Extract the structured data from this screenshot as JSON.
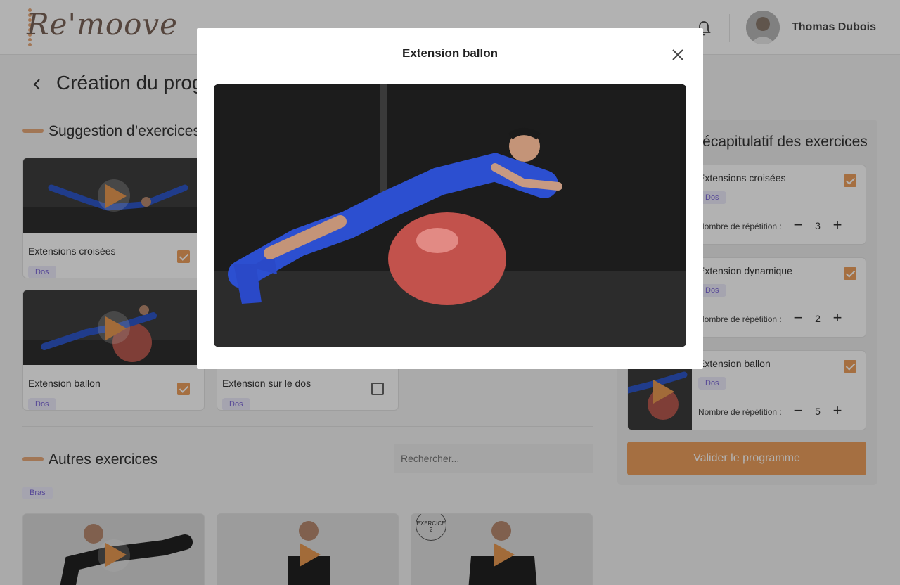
{
  "header": {
    "logo_text": "Re'moove",
    "user_name": "Thomas Dubois"
  },
  "page": {
    "title": "Création du programme"
  },
  "suggestions": {
    "title": "Suggestion d’exercices",
    "cards": [
      {
        "name": "Extensions croisées",
        "tag": "Dos",
        "checked": true
      },
      {
        "name": "Extension ballon",
        "tag": "Dos",
        "checked": true
      },
      {
        "name": "Extension sur le dos",
        "tag": "Dos",
        "checked": false
      }
    ]
  },
  "others": {
    "title": "Autres exercices",
    "search_placeholder": "Rechercher...",
    "filter_tag": "Bras",
    "badge_text": "EXERCICE 2"
  },
  "recap": {
    "title": "Récapitulatif des exercices",
    "rep_label": "Nombre de répétition :",
    "items": [
      {
        "name": "Extensions croisées",
        "tag": "Dos",
        "reps": 3
      },
      {
        "name": "Extension dynamique",
        "tag": "Dos",
        "reps": 2
      },
      {
        "name": "Extension ballon",
        "tag": "Dos",
        "reps": 5
      }
    ],
    "validate_label": "Valider le programme"
  },
  "modal": {
    "title": "Extension ballon"
  },
  "colors": {
    "accent": "#eda05d",
    "tag_text": "#7c67d8",
    "tag_bg": "#ecebfb"
  }
}
